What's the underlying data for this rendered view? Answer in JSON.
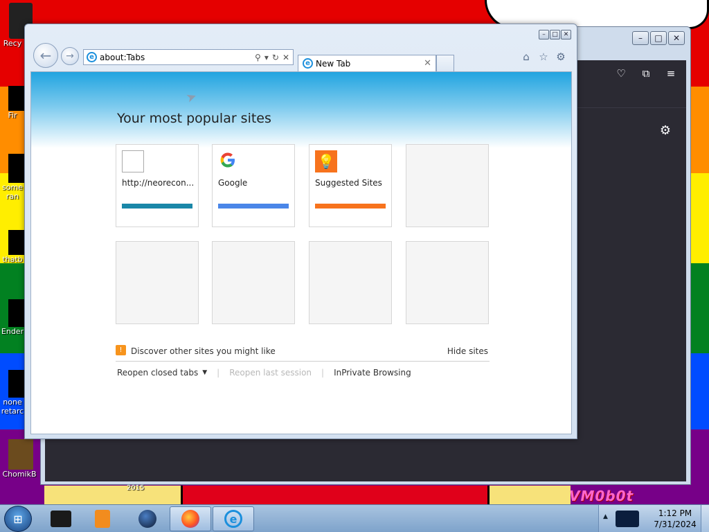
{
  "desktop": {
    "wallpaper_colors": [
      "#e50000",
      "#ff8d00",
      "#ffee00",
      "#028121",
      "#004cff",
      "#770088"
    ],
    "icons": [
      {
        "label": "Recy",
        "icon": "recycle-bin-icon"
      },
      {
        "label": "Fir",
        "icon": "firefox-shortcut-icon"
      },
      {
        "label": "some",
        "icon": "shortcut-icon"
      },
      {
        "label": "ran",
        "icon": "shortcut-icon"
      },
      {
        "label": "thatb",
        "icon": "shortcut-icon"
      },
      {
        "label": "Ender",
        "icon": "shortcut-icon"
      },
      {
        "label": "none",
        "icon": "shortcut-icon"
      },
      {
        "label": "retarc",
        "icon": "shortcut-icon"
      },
      {
        "label": "ChomikB",
        "icon": "shortcut-icon"
      }
    ],
    "watermark": "VM0b0t",
    "year_text": "2015"
  },
  "ie": {
    "address": "about:Tabs",
    "tab_title": "New Tab",
    "popular_title": "Your most popular sites",
    "tiles": [
      {
        "label": "http://neorecon...",
        "bar_color": "#1a87a8",
        "icon": "blank-page-icon"
      },
      {
        "label": "Google",
        "bar_color": "#4a86e8",
        "icon": "google-g-icon"
      },
      {
        "label": "Suggested Sites",
        "bar_color": "#f7731d",
        "icon": "lightbulb-icon"
      }
    ],
    "discover_text": "Discover other sites you might like",
    "hide_sites": "Hide sites",
    "reopen_closed": "Reopen closed tabs",
    "reopen_last": "Reopen last session",
    "inprivate": "InPrivate Browsing"
  },
  "taskbar": {
    "time": "1:12 PM",
    "date": "7/31/2024"
  }
}
